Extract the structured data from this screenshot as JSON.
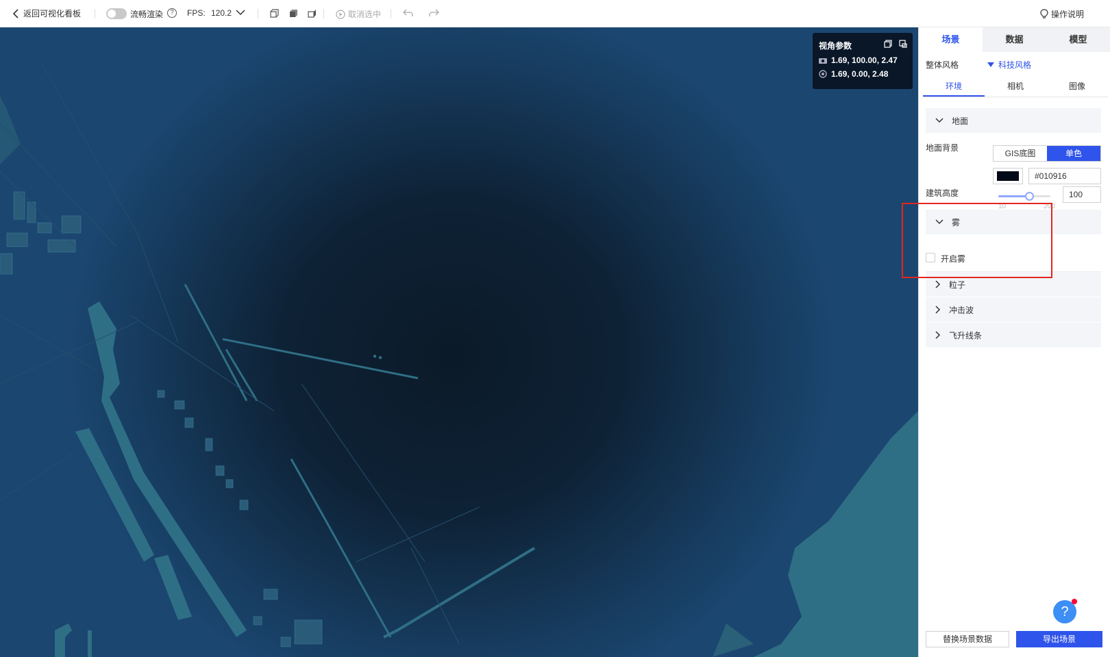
{
  "toolbar": {
    "back_label": "返回可视化看板",
    "render_label": "流畅渲染",
    "render_help": "?",
    "fps_label": "FPS:",
    "fps_value": "120.2",
    "cancel_select_label": "取消选中",
    "guide_label": "操作说明"
  },
  "camera": {
    "title": "视角参数",
    "position": "1.69, 100.00, 2.47",
    "target": "1.69, 0.00, 2.48"
  },
  "panel": {
    "tabs": [
      "场景",
      "数据",
      "模型"
    ],
    "active_tab": "场景",
    "style_label": "整体风格",
    "style_value": "科技风格",
    "sub_tabs": [
      "环境",
      "相机",
      "图像"
    ],
    "active_sub_tab": "环境",
    "ground": {
      "section_title": "地面",
      "bg_label": "地面背景",
      "bg_options": [
        "GIS底图",
        "单色"
      ],
      "bg_selected": "单色",
      "color_hex": "#010916",
      "height_label": "建筑高度",
      "slider_min": "10",
      "slider_max": "200",
      "height_value": "100"
    },
    "fog": {
      "section_title": "雾",
      "enable_label": "开启雾",
      "enabled": false
    },
    "sections": [
      "粒子",
      "冲击波",
      "飞升线条"
    ],
    "help_fab": "?",
    "buttons": {
      "replace": "替换场景数据",
      "export": "导出场景"
    }
  },
  "colors": {
    "accent": "#2f54eb",
    "highlight_box": "#e3261f",
    "map_water": "#163a5c",
    "map_land": "#2f6f86"
  }
}
